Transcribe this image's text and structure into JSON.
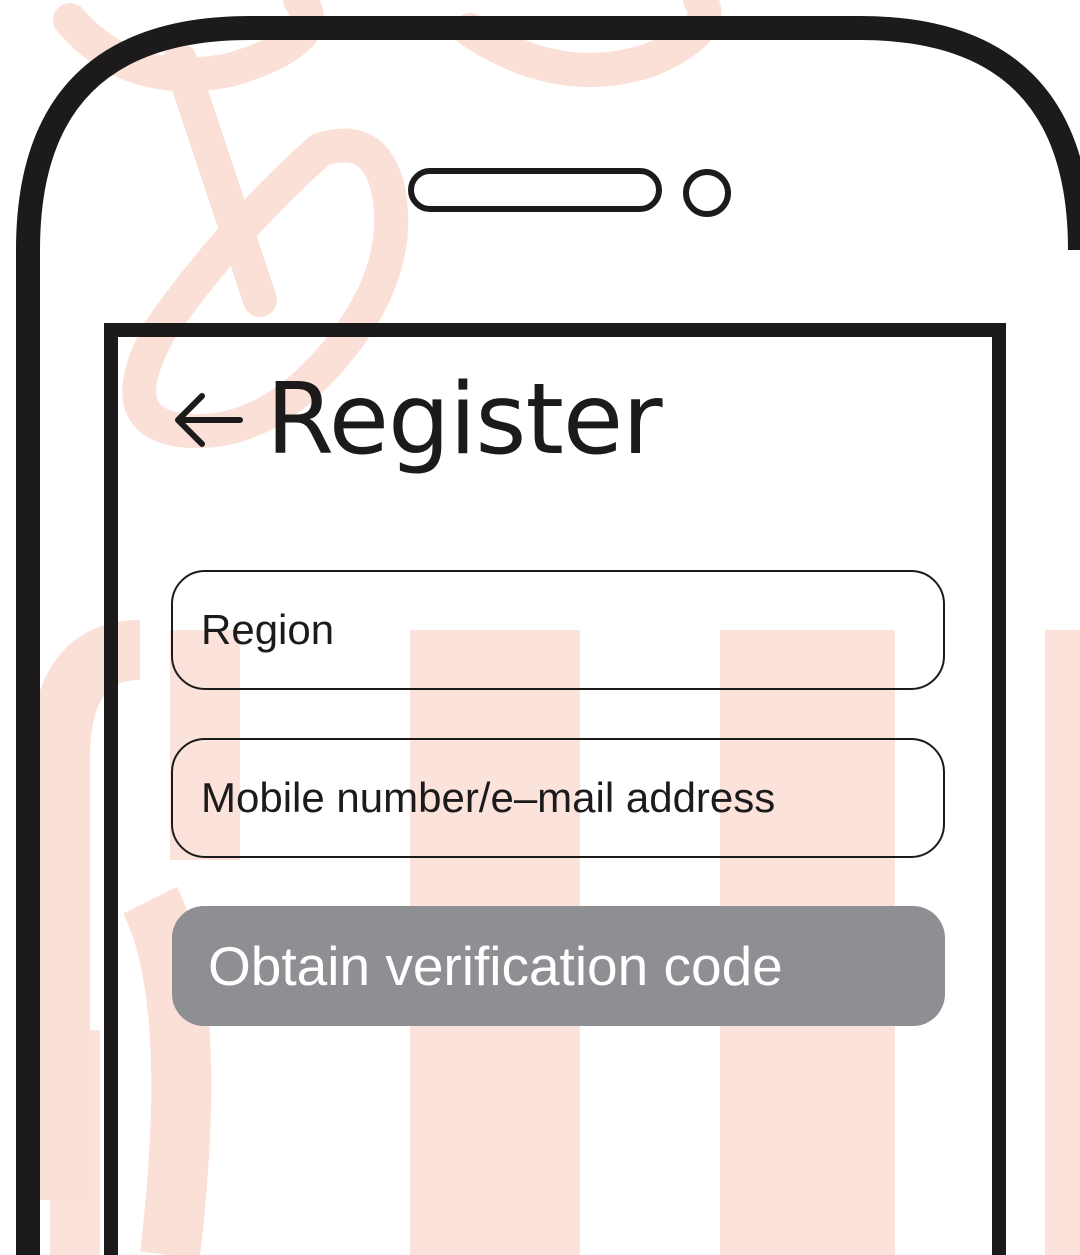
{
  "header": {
    "title": "Register",
    "back_icon": "arrow-left-icon"
  },
  "form": {
    "region_placeholder": "Region",
    "contact_placeholder": "Mobile number/e–mail address",
    "obtain_code_label": "Obtain verification code"
  },
  "colors": {
    "outline": "#1c1a1b",
    "button_background": "#8e8f93",
    "button_text": "#ffffff",
    "watermark": "#fbe0d8"
  }
}
